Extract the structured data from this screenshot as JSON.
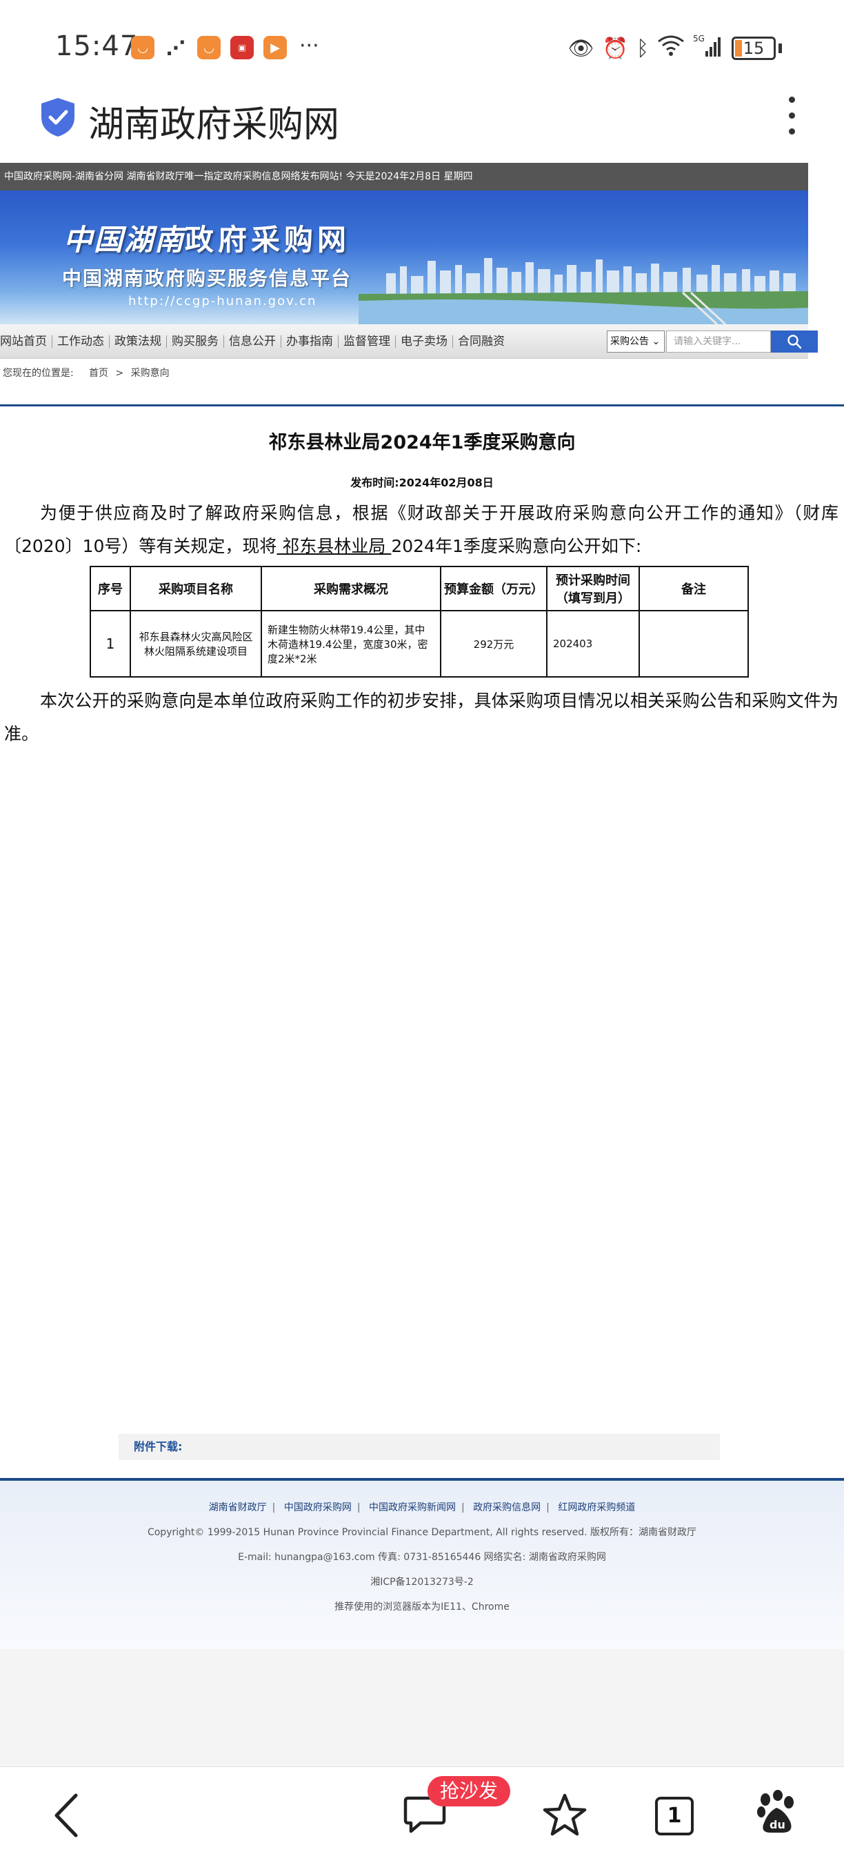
{
  "status_bar": {
    "time": "15:47",
    "battery": "15"
  },
  "app": {
    "title": "湖南政府采购网"
  },
  "site": {
    "topline": "中国政府采购网-湖南省分网 湖南省财政厅唯一指定政府采购信息网络发布网站! 今天是2024年2月8日 星期四",
    "banner_logo_a": "中国湖南",
    "banner_logo_b": "政府采购网",
    "banner_sub": "中国湖南政府购买服务信息平台",
    "banner_url": "http://ccgp-hunan.gov.cn",
    "nav": [
      "网站首页",
      "工作动态",
      "政策法规",
      "购买服务",
      "信息公开",
      "办事指南",
      "监督管理",
      "电子卖场",
      "合同融资"
    ],
    "search_select": "采购公告",
    "search_placeholder": "请输入关键字...",
    "breadcrumb_label": "您现在的位置是:",
    "breadcrumb_home": "首页",
    "breadcrumb_sep": ">",
    "breadcrumb_current": "采购意向"
  },
  "article": {
    "title": "祁东县林业局2024年1季度采购意向",
    "publish": "发布时间:2024年02月08日",
    "para1_a": "为便于供应商及时了解政府采购信息，根据《财政部关于开展政府采购意向公开工作的通知》（财库〔2020〕10号）等有关规定，现将",
    "para1_u": " 祁东县林业局 ",
    "para1_b": "2024年1季度采购意向公开如下:",
    "table": {
      "headers": [
        "序号",
        "采购项目名称",
        "采购需求概况",
        "预算金额（万元）",
        "预计采购时间（填写到月）",
        "备注"
      ],
      "rows": [
        [
          "1",
          "祁东县森林火灾高风险区林火阻隔系统建设项目",
          "新建生物防火林带19.4公里，其中木荷造林19.4公里，宽度30米，密度2米*2米",
          "292万元",
          "202403",
          ""
        ]
      ]
    },
    "para2": "本次公开的采购意向是本单位政府采购工作的初步安排，具体采购项目情况以相关采购公告和采购文件为准。",
    "attachment_label": "附件下载:"
  },
  "footer": {
    "links": [
      "湖南省财政厅",
      "中国政府采购网",
      "中国政府采购新闻网",
      "政府采购信息网",
      "红网政府采购频道"
    ],
    "copyright": "Copyright© 1999-2015 Hunan Province Provincial Finance Department, All rights reserved. 版权所有：湖南省财政厅",
    "contact": "E-mail: hunangpa@163.com 传真: 0731-85165446 网络实名: 湖南省政府采购网",
    "icp": "湘ICP备12013273号-2",
    "browser": "推荐使用的浏览器版本为IE11、Chrome"
  },
  "bottom_bar": {
    "sofa_badge": "抢沙发",
    "tab_count": "1"
  }
}
